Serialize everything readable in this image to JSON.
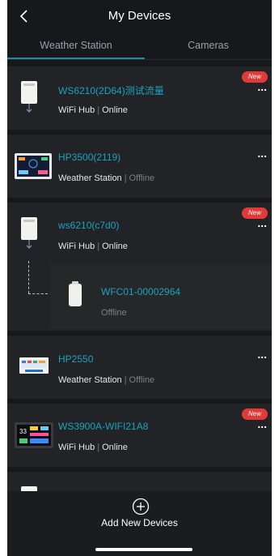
{
  "header": {
    "title": "My Devices",
    "back_icon": "chevron-left-icon"
  },
  "tabs": [
    {
      "label": "Weather Station",
      "active": true
    },
    {
      "label": "Cameras",
      "active": false
    }
  ],
  "accent_color": "#1e8fa3",
  "name_color": "#1aa3c0",
  "badge_color": "#e23a3a",
  "devices": [
    {
      "name": "WS6210(2D64)测试流量",
      "type": "WiFi Hub",
      "status": "Online",
      "badge": "New",
      "more": "..."
    },
    {
      "name": "HP3500(2119)",
      "type": "Weather Station",
      "status": "Offline",
      "more": "..."
    },
    {
      "name": "ws6210(c7d0)",
      "type": "WiFi Hub",
      "status": "Online",
      "badge": "New",
      "more": "...",
      "sub_device": {
        "name": "WFC01-00002964",
        "status": "Offline"
      }
    },
    {
      "name": "HP2550",
      "type": "Weather Station",
      "status": "Offline",
      "more": "..."
    },
    {
      "name": "WS3900A-WIFI21A8",
      "type": "WiFi Hub",
      "status": "Online",
      "badge": "New",
      "more": "..."
    },
    {
      "more": "..."
    }
  ],
  "footer": {
    "add_label": "Add New Devices",
    "add_icon": "plus-circle-icon"
  }
}
